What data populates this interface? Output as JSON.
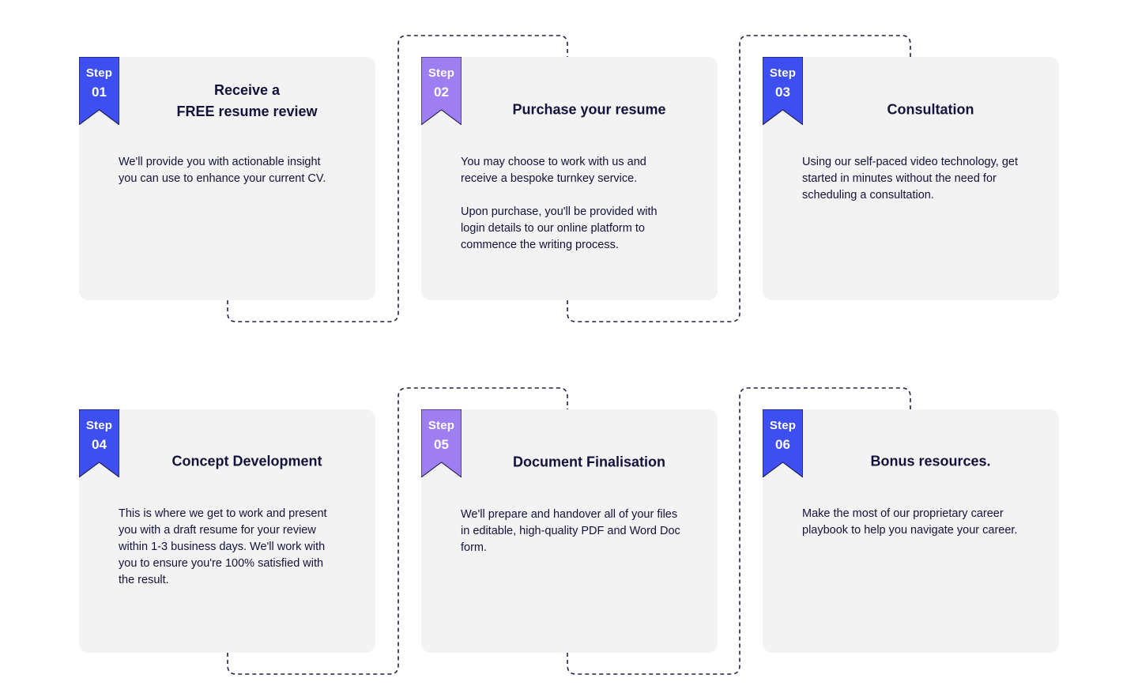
{
  "colors": {
    "card_background": "#f3f3f4",
    "ribbon_blue": "#3d4ff0",
    "ribbon_purple": "#9f7ef2",
    "text_dark": "#13123a",
    "connector": "#22214a"
  },
  "steps": [
    {
      "step_word": "Step",
      "number": "01",
      "title": "Receive a\nFREE resume review",
      "description": "We'll provide you with actionable insight you can use to enhance your current CV.",
      "ribbon_color": "#3d4ff0"
    },
    {
      "step_word": "Step",
      "number": "02",
      "title": "Purchase your resume",
      "description": "You may choose to work with us and receive a bespoke turnkey service.\n\nUpon purchase, you'll be provided with login details to our online platform to commence the writing process.",
      "ribbon_color": "#9f7ef2"
    },
    {
      "step_word": "Step",
      "number": "03",
      "title": "Consultation",
      "description": "Using our self-paced video technology, get started in minutes without the need for scheduling a consultation.",
      "ribbon_color": "#3d4ff0"
    },
    {
      "step_word": "Step",
      "number": "04",
      "title": "Concept Development",
      "description": "This is where we get to work and present you with a draft resume for your review within 1-3 business days. We'll work with you to ensure you're 100% satisfied with the result.",
      "ribbon_color": "#3d4ff0"
    },
    {
      "step_word": "Step",
      "number": "05",
      "title": "Document Finalisation",
      "description": "We'll prepare and handover all of your files in editable, high-quality PDF and Word Doc form.",
      "ribbon_color": "#9f7ef2"
    },
    {
      "step_word": "Step",
      "number": "06",
      "title": "Bonus resources.",
      "description": "Make the most of our proprietary career playbook to help you navigate your career.",
      "ribbon_color": "#3d4ff0"
    }
  ]
}
